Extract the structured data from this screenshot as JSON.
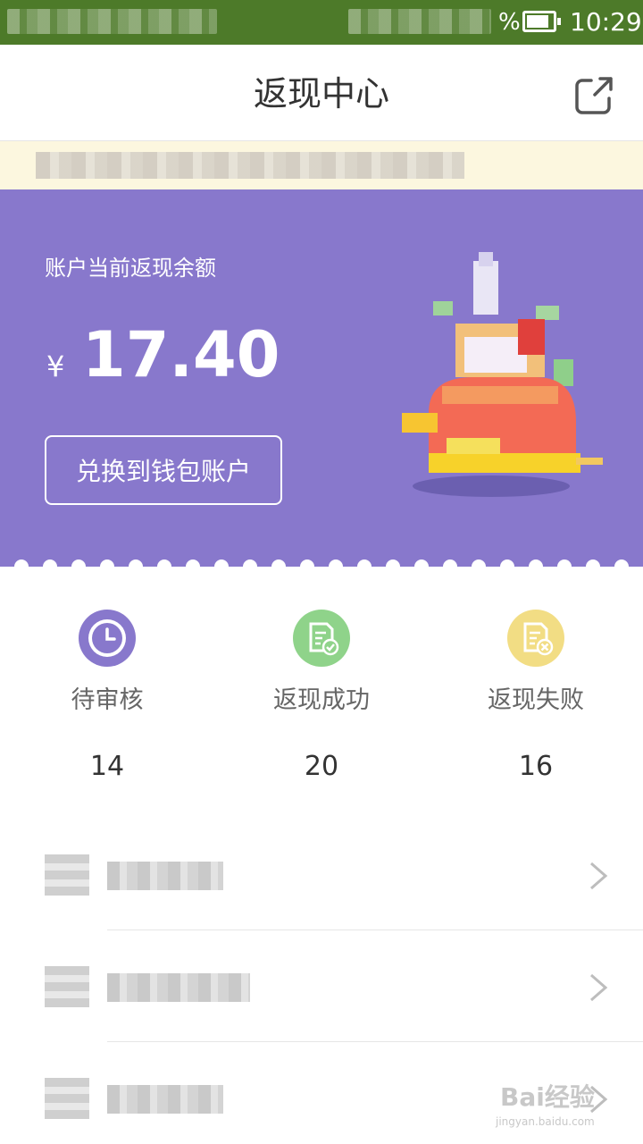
{
  "status_bar": {
    "battery_percent_symbol": "%",
    "time": "10:29",
    "battery_level": 0.85
  },
  "header": {
    "title": "返现中心",
    "share_icon": "share-external-icon"
  },
  "balance_card": {
    "label": "账户当前返现余额",
    "currency": "¥",
    "amount": "17.40",
    "exchange_button": "兑换到钱包账户",
    "background_color": "#8878cc"
  },
  "stats": [
    {
      "label": "待审核",
      "count": "14",
      "icon": "clock-icon",
      "color": "#8878cc"
    },
    {
      "label": "返现成功",
      "count": "20",
      "icon": "document-check-icon",
      "color": "#8fd38a"
    },
    {
      "label": "返现失败",
      "count": "16",
      "icon": "document-x-icon",
      "color": "#f2dd84"
    }
  ],
  "menu": {
    "chevron_icon": "chevron-right-icon"
  },
  "watermark": {
    "brand": "Bai经验",
    "url": "jingyan.baidu.com"
  }
}
